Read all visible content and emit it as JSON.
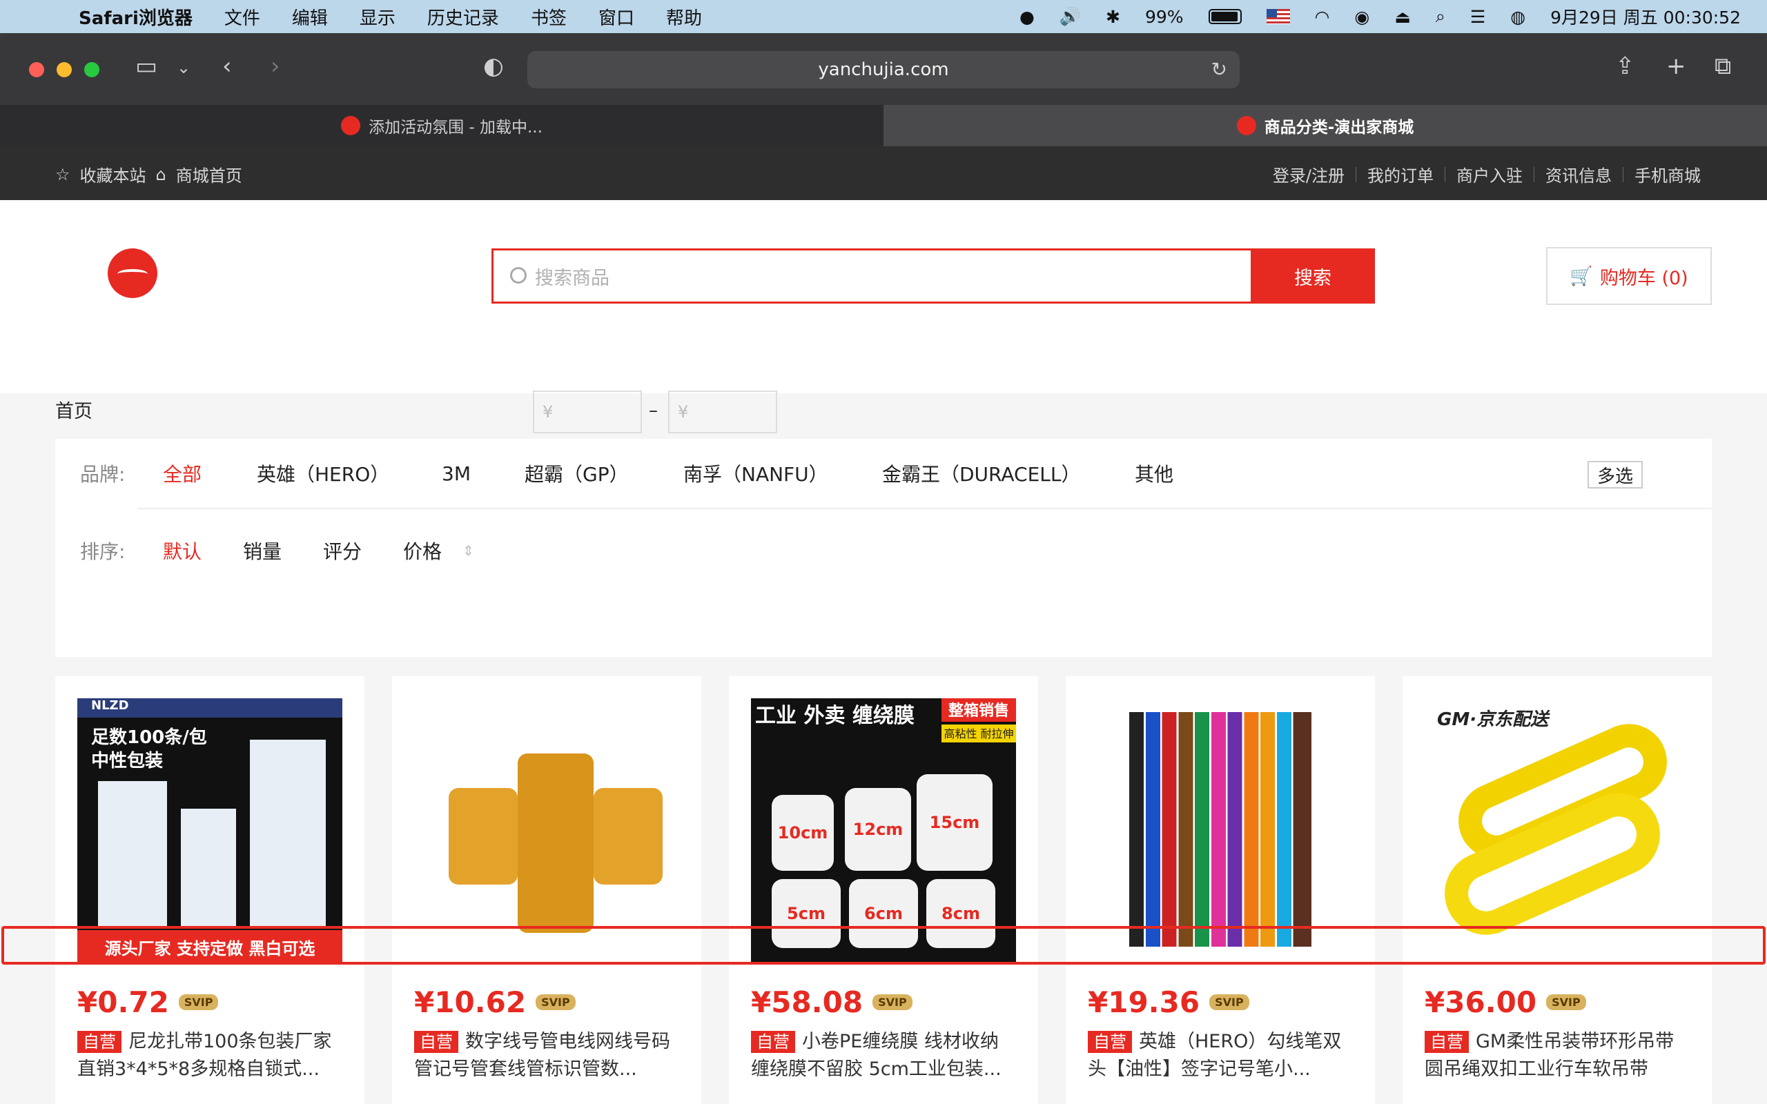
{
  "menubar": {
    "app_name": "Safari浏览器",
    "menus": [
      "文件",
      "编辑",
      "显示",
      "历史记录",
      "书签",
      "窗口",
      "帮助"
    ],
    "battery": "99%",
    "datetime": "9月29日 周五 00:30:52"
  },
  "browser": {
    "url": "yanchujia.com",
    "tabs": [
      {
        "label": "添加活动氛围 - 加载中..."
      },
      {
        "label": "商品分类-演出家商城"
      }
    ]
  },
  "topbar": {
    "bookmark": "收藏本站",
    "home": "商城首页",
    "links": [
      "登录/注册",
      "我的订单",
      "商户入驻",
      "资讯信息",
      "手机商城"
    ]
  },
  "header": {
    "search_placeholder": "搜索商品",
    "search_button": "搜索",
    "cart_label": "购物车 (0)"
  },
  "breadcrumb": "首页",
  "filter": {
    "brand_label": "品牌:",
    "brands": [
      "全部",
      "英雄（HERO）",
      "3M",
      "超霸（GP）",
      "南孚（NANFU）",
      "金霸王（DURACELL）",
      "其他"
    ],
    "multi_select": "多选",
    "sort_label": "排序:",
    "sorts": [
      "默认",
      "销量",
      "评分",
      "价格"
    ],
    "price_min_placeholder": "¥",
    "price_max_placeholder": "¥",
    "price_sep": "–"
  },
  "products": [
    {
      "price": "¥0.72",
      "badge": "SVIP",
      "tag": "自营",
      "title": "尼龙扎带100条包装厂家直销3*4*5*8多规格自锁式...",
      "image": "cable-ties",
      "banner": "源头厂家  支持定做  黑白可选",
      "img_heading": "足数100条/包 中性包装",
      "img_brand": "NLZD"
    },
    {
      "price": "¥10.62",
      "badge": "SVIP",
      "tag": "自营",
      "title": "数字线号管电线网线号码管记号管套线管标识管数...",
      "image": "wire-markers"
    },
    {
      "price": "¥58.08",
      "badge": "SVIP",
      "tag": "自营",
      "title": "小卷PE缠绕膜 线材收纳缠绕膜不留胶 5cm工业包装...",
      "image": "stretch-film",
      "img_heading": "工业 外卖 缠绕膜",
      "img_badge": "整箱销售",
      "img_sub": "高粘性 耐拉伸",
      "img_sizes": [
        "10cm",
        "12cm",
        "15cm",
        "5cm",
        "6cm",
        "8cm"
      ]
    },
    {
      "price": "¥19.36",
      "badge": "SVIP",
      "tag": "自营",
      "title": "英雄（HERO）勾线笔双头【油性】签字记号笔小...",
      "image": "markers"
    },
    {
      "price": "¥36.00",
      "badge": "SVIP",
      "tag": "自营",
      "title": "GM柔性吊装带环形吊带圆吊绳双扣工业行车软吊带",
      "image": "lifting-sling",
      "img_brand": "GM·京东配送"
    }
  ],
  "colors": {
    "accent": "#e62a22",
    "dark_bar": "#2e2e2e"
  }
}
